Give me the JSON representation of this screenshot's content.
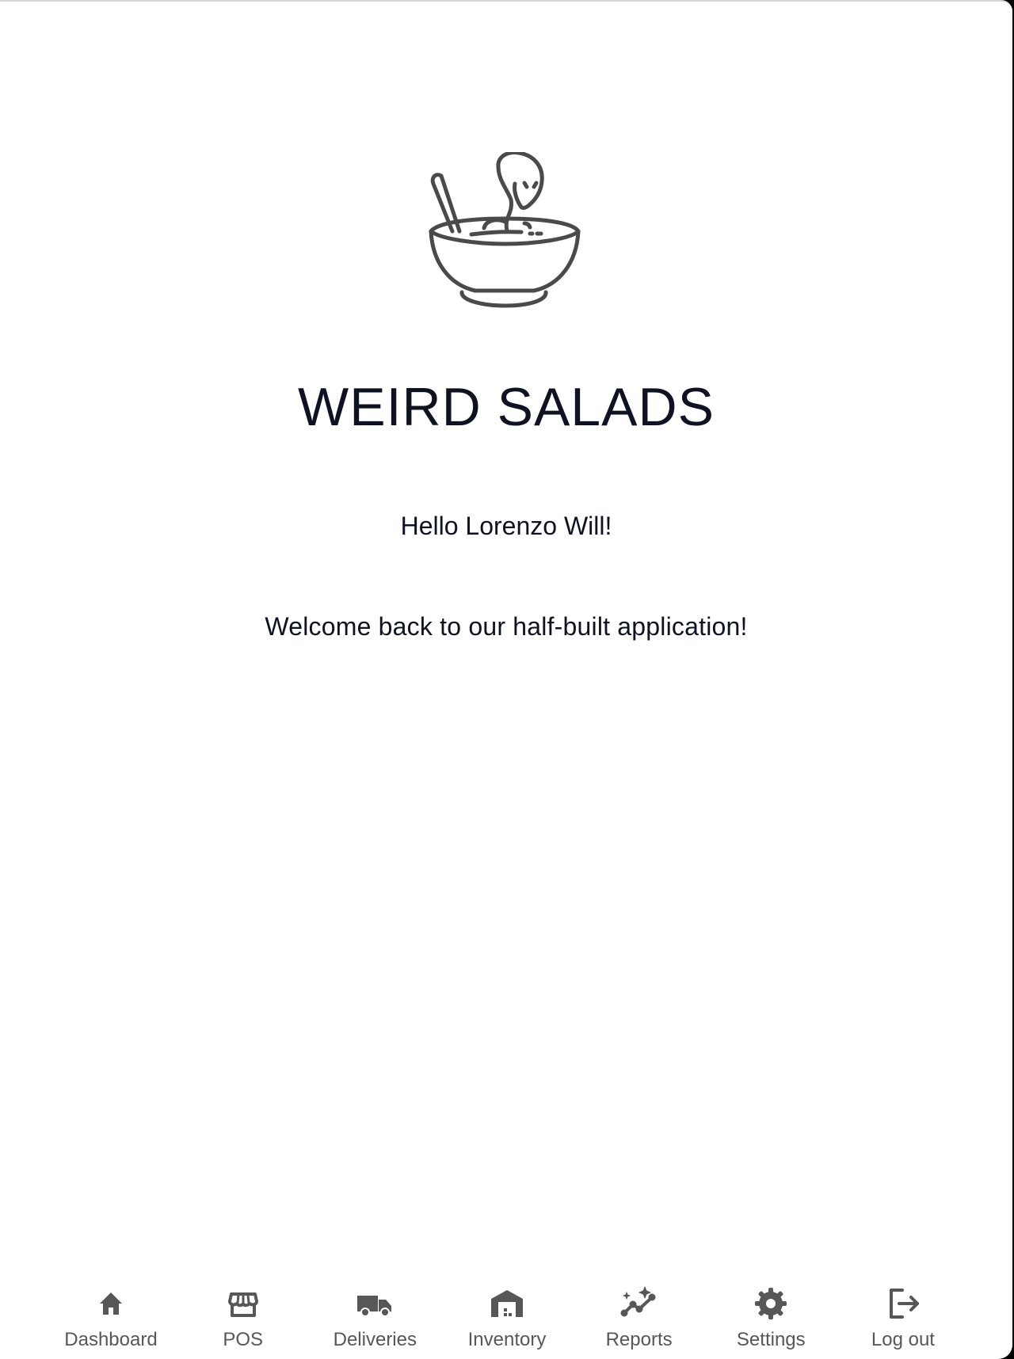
{
  "app": {
    "title": "WEIRD SALADS",
    "logo_icon": "snake-in-salad-bowl-icon"
  },
  "main": {
    "greeting": "Hello Lorenzo Will!",
    "welcome": "Welcome back to our half-built application!"
  },
  "nav": {
    "items": [
      {
        "label": "Dashboard",
        "icon": "home-icon"
      },
      {
        "label": "POS",
        "icon": "store-icon"
      },
      {
        "label": "Deliveries",
        "icon": "truck-icon"
      },
      {
        "label": "Inventory",
        "icon": "warehouse-icon"
      },
      {
        "label": "Reports",
        "icon": "sparkle-chart-icon"
      },
      {
        "label": "Settings",
        "icon": "gear-icon"
      },
      {
        "label": "Log out",
        "icon": "logout-icon"
      }
    ]
  },
  "colors": {
    "text": "#0e1222",
    "icon": "#575757",
    "background": "#ffffff"
  }
}
